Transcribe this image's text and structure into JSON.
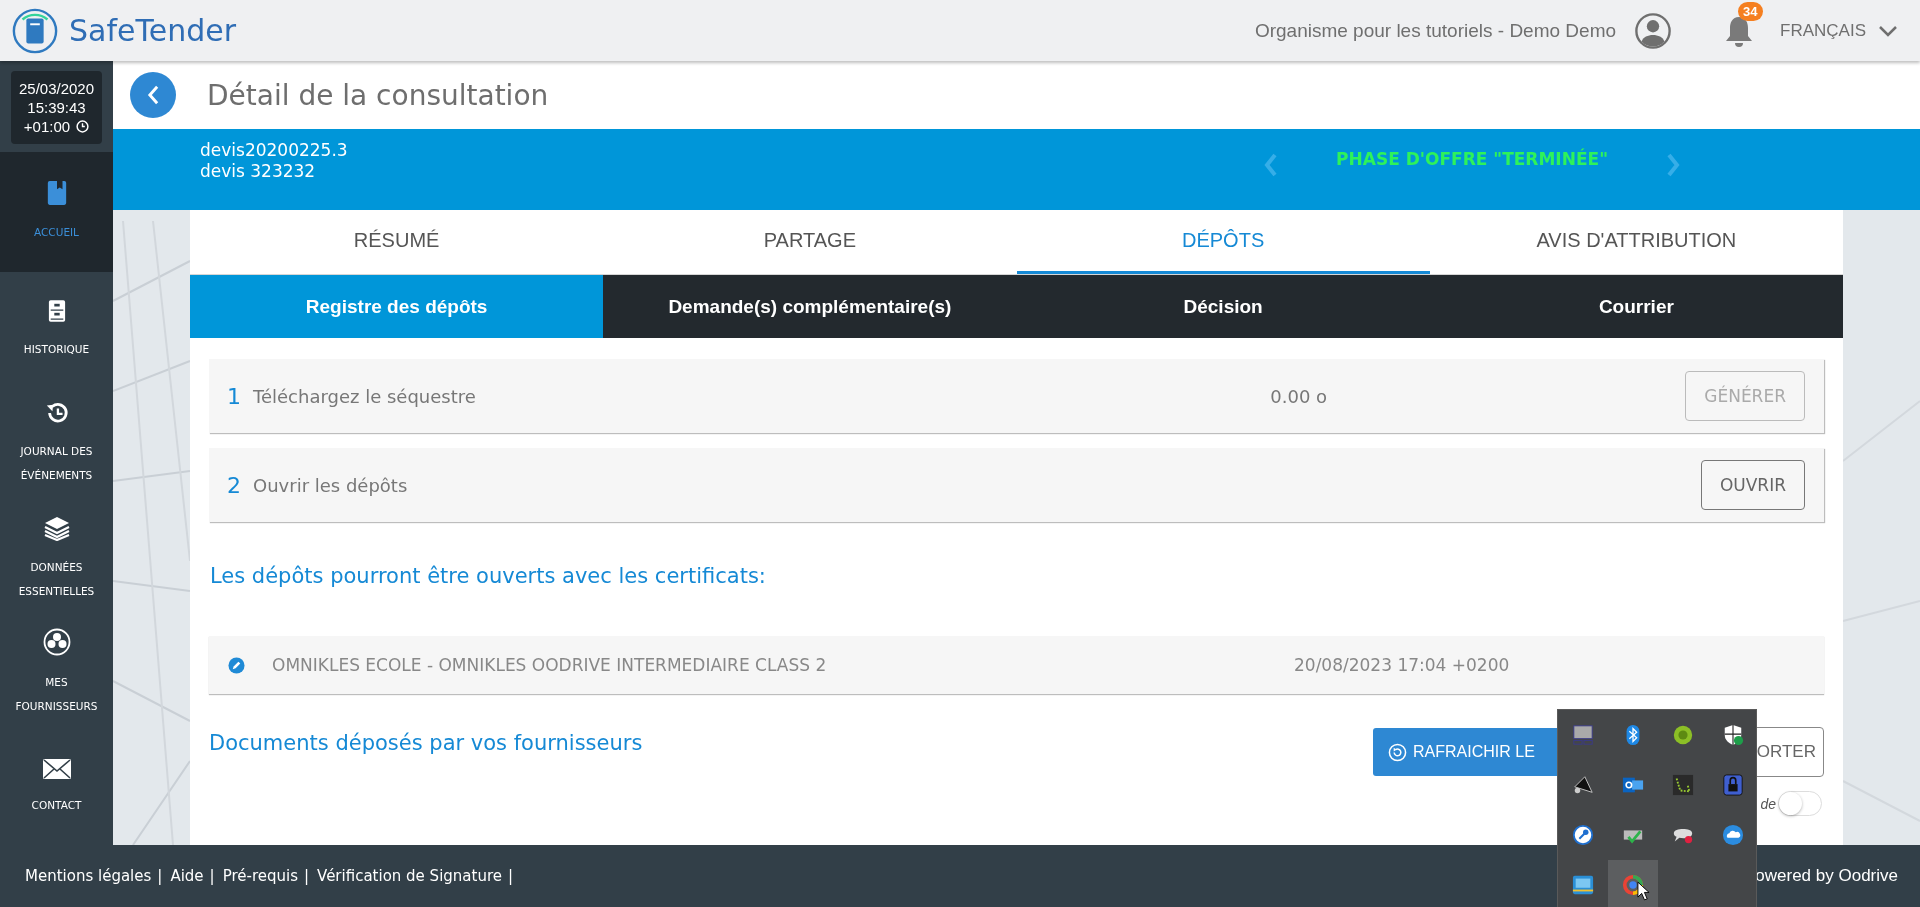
{
  "header": {
    "brand": "SafeTender",
    "organisation": "Organisme pour les tutoriels - Demo Demo",
    "notifications": "34",
    "language": "FRANÇAIS"
  },
  "clock": {
    "date": "25/03/2020",
    "time": "15:39:43",
    "offset": "+01:00"
  },
  "sidebar": {
    "items": [
      {
        "label": "ACCUEIL",
        "selected": true
      },
      {
        "label": "HISTORIQUE",
        "selected": false
      },
      {
        "label": "JOURNAL DES ÉVÉNEMENTS",
        "selected": false
      },
      {
        "label": "DONNÉES ESSENTIELLES",
        "selected": false
      },
      {
        "label": "MES FOURNISSEURS",
        "selected": false
      },
      {
        "label": "CONTACT",
        "selected": false
      }
    ]
  },
  "page": {
    "title": "Détail de la consultation"
  },
  "consultation": {
    "reference": "devis20200225.3",
    "name": "devis 323232",
    "phase": "PHASE D'OFFRE \"TERMINÉE\""
  },
  "tabs": [
    {
      "label": "RÉSUMÉ",
      "selected": false
    },
    {
      "label": "PARTAGE",
      "selected": false
    },
    {
      "label": "DÉPÔTS",
      "selected": true
    },
    {
      "label": "AVIS D'ATTRIBUTION",
      "selected": false
    }
  ],
  "subtabs": [
    {
      "label": "Registre des dépôts",
      "selected": true
    },
    {
      "label": "Demande(s) complémentaire(s)",
      "selected": false
    },
    {
      "label": "Décision",
      "selected": false
    },
    {
      "label": "Courrier",
      "selected": false
    }
  ],
  "steps": [
    {
      "number": "1",
      "label": "Téléchargez le séquestre",
      "size": "0.00 o",
      "button": "GÉNÉRER",
      "disabled": true
    },
    {
      "number": "2",
      "label": "Ouvrir les dépôts",
      "button": "OUVRIR",
      "disabled": false
    }
  ],
  "certificates": {
    "heading": "Les dépôts pourront être ouverts avec les certificats:",
    "items": [
      {
        "name": "OMNIKLES ECOLE - OMNIKLES OODRIVE INTERMEDIAIRE CLASS 2",
        "date": "20/08/2023 17:04 +0200"
      }
    ]
  },
  "documents": {
    "heading": "Documents déposés par vos fournisseurs",
    "refresh_button": "RAFRAICHIR LE",
    "export_button": "ORTER",
    "toggle_label": "de",
    "toggle_on": false
  },
  "footer": {
    "links": [
      {
        "label": "Mentions légales",
        "separator": "|"
      },
      {
        "label": "Aide",
        "separator": "|"
      },
      {
        "label": "Pré-requis",
        "separator": "|"
      },
      {
        "label": "Vérification de Signature",
        "separator": "|"
      }
    ],
    "powered_by": "owered by Oodrive"
  },
  "tray": {
    "items": [
      {
        "selected": false
      },
      {
        "selected": false
      },
      {
        "selected": false
      },
      {
        "selected": false
      },
      {
        "selected": false
      },
      {
        "selected": false
      },
      {
        "selected": false
      },
      {
        "selected": false
      },
      {
        "selected": false
      },
      {
        "selected": false
      },
      {
        "selected": false
      },
      {
        "selected": false
      },
      {
        "selected": false
      },
      {
        "selected": true
      }
    ]
  }
}
